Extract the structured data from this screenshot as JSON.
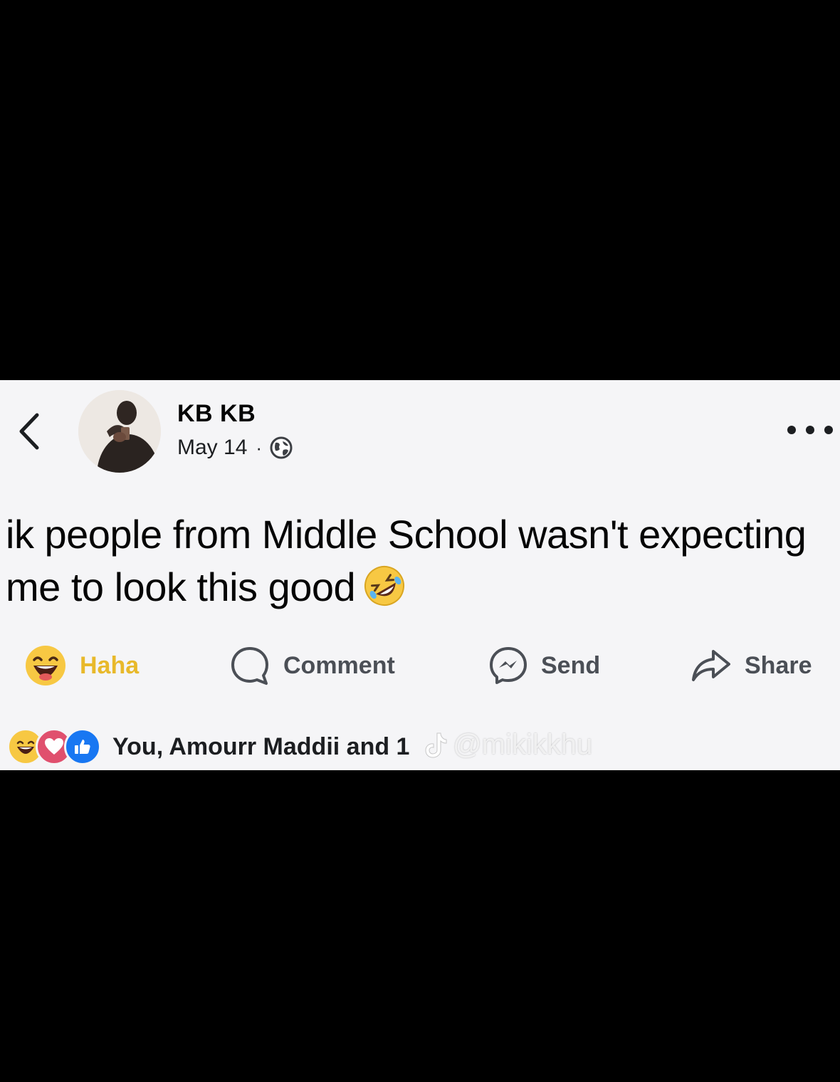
{
  "post": {
    "author_name": "KB KB",
    "date": "May 14",
    "separator": "·",
    "privacy_icon": "globe-icon",
    "text": "ik people from Middle School wasn't expecting me to look this good",
    "text_emoji": "rolling-on-floor-laughing-emoji"
  },
  "actions": {
    "haha_label": "Haha",
    "comment_label": "Comment",
    "send_label": "Send",
    "share_label": "Share"
  },
  "reactions": {
    "icons": [
      "haha-icon",
      "love-icon",
      "like-icon"
    ],
    "summary": "You, Amourr Maddii and 1"
  },
  "watermark": {
    "text": "@mikikkhu"
  },
  "colors": {
    "background": "#000000",
    "card": "#f5f5f7",
    "haha_yellow": "#e8b92b",
    "love_pink": "#e0506e",
    "like_blue": "#1877f2"
  }
}
